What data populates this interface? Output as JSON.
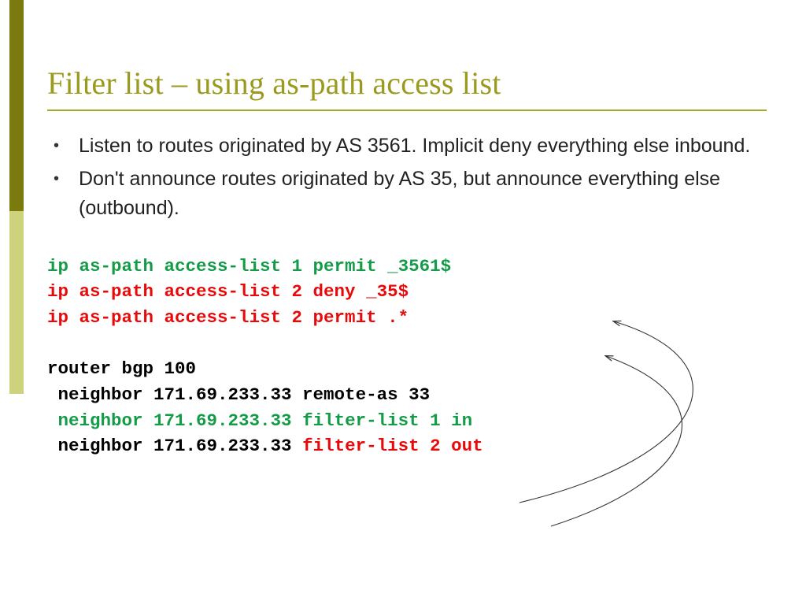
{
  "title": "Filter list – using as-path access list",
  "bullets": [
    "Listen to routes originated by AS 3561. Implicit deny everything else inbound.",
    "Don't announce routes originated by AS 35, but announce everything else (outbound)."
  ],
  "code": {
    "l1": "ip as-path access-list 1 permit _3561$",
    "l2": "ip as-path access-list 2 deny _35$",
    "l3": "ip as-path access-list 2 permit .*",
    "l4": "",
    "l5": "router bgp 100",
    "l6": " neighbor 171.69.233.33 remote-as 33",
    "l7pre": " ",
    "l7": "neighbor 171.69.233.33 filter-list 1 in",
    "l8pre": " neighbor 171.69.233.33 ",
    "l8": "filter-list 2 out"
  }
}
